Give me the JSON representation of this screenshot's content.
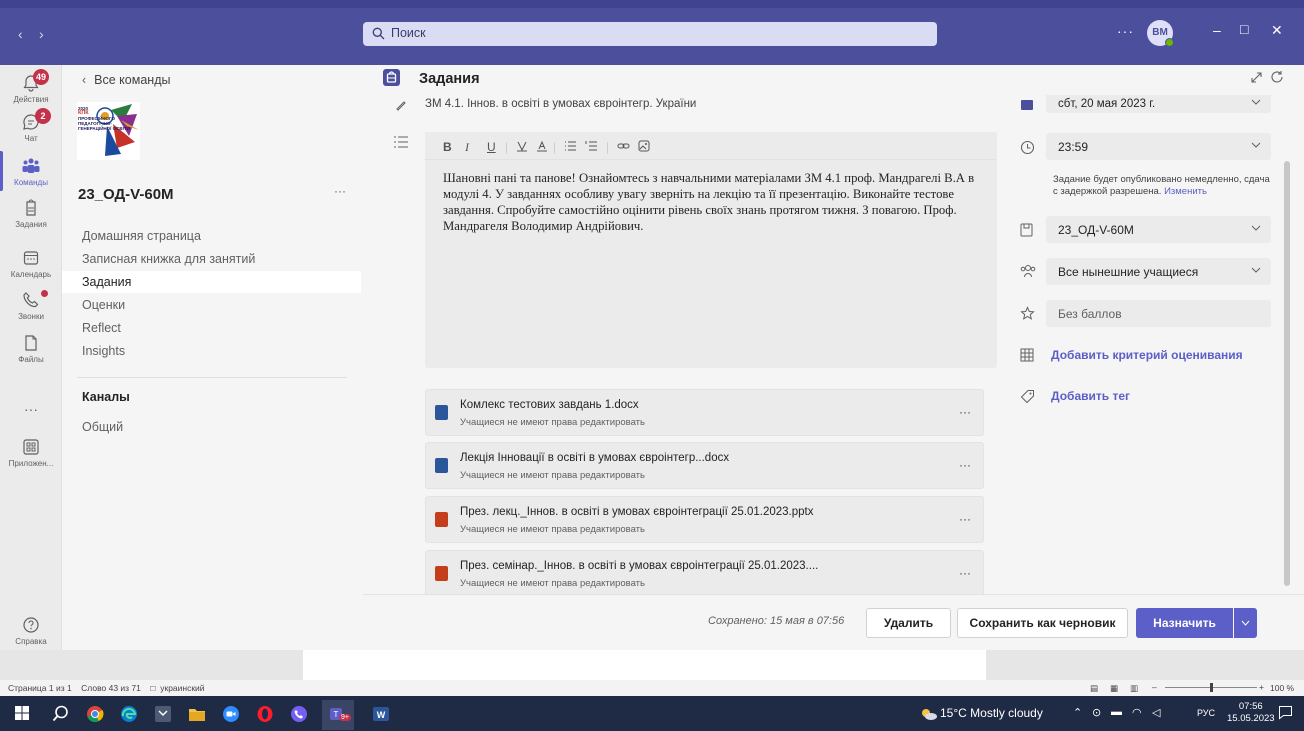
{
  "titlebar": {
    "search_placeholder": "Поиск",
    "more": "···",
    "avatar_initials": "ВМ"
  },
  "rail": {
    "items": [
      {
        "label": "Действия",
        "badge": "49"
      },
      {
        "label": "Чат",
        "badge": "2"
      },
      {
        "label": "Команды"
      },
      {
        "label": "Задания"
      },
      {
        "label": "Календарь"
      },
      {
        "label": "Звонки"
      },
      {
        "label": "Файлы"
      },
      {
        "label": "···"
      },
      {
        "label": "Приложен..."
      },
      {
        "label": "Справка"
      }
    ]
  },
  "team": {
    "back": "Все команды",
    "name": "23_ОД-V-60М",
    "more": "···",
    "logo_text": [
      "2020",
      "КПК",
      "ПРОФЕСІЙНОГО",
      "ПЕДАГОГІЧНО-",
      "ГЕНЕРАЦІЙНОЇ ОСВІТИ"
    ],
    "nav": [
      "Домашняя страница",
      "Записная книжка для занятий",
      "Задания",
      "Оценки",
      "Reflect",
      "Insights"
    ],
    "channels_title": "Каналы",
    "channels": [
      "Общий"
    ]
  },
  "main": {
    "title": "Задания",
    "assignment_title": "ЗМ 4.1. Іннов. в освіті в умовах євроінтегр. України",
    "description": "Шановні пані та панове! Ознайомтесь з навчальними матеріалами ЗМ 4.1 проф. Мандрагелі В.А в модулі 4. У завданнях особливу увагу зверніть на лекцію та її презентацію. Виконайте тестове завдання. Спробуйте самостійно оцінити рівень своїх знань протягом тижня. З повагою. Проф. Мандрагеля Володимир Андрійович.",
    "attachments": [
      {
        "name": "Комлекс тестових завдань 1.docx",
        "note": "Учащиеся не имеют права редактировать",
        "type": "word"
      },
      {
        "name": "Лекція Інновації в освіті в умовах євроінтегр...docx",
        "note": "Учащиеся не имеют права редактировать",
        "type": "word"
      },
      {
        "name": "През. лекц._Іннов. в освіті в умовах євроінтеграції 25.01.2023.pptx",
        "note": "Учащиеся не имеют права редактировать",
        "type": "ppt"
      },
      {
        "name": "През. семінар._Іннов. в освіті в умовах євроінтеграції 25.01.2023....",
        "note": "Учащиеся не имеют права редактировать",
        "type": "ppt"
      }
    ],
    "attachment_more": "···"
  },
  "right": {
    "due_date": "сбт, 20 мая 2023 г.",
    "due_time": "23:59",
    "publish_note": "Задание будет опубликовано немедленно, сдача с задержкой разрешена.",
    "publish_change": "Изменить",
    "class": "23_ОД-V-60М",
    "students": "Все нынешние учащиеся",
    "points": "Без баллов",
    "add_rubric": "Добавить критерий оценивания",
    "add_tag": "Добавить тег"
  },
  "footer": {
    "saved": "Сохранено: 15 мая в 07:56",
    "delete": "Удалить",
    "save_draft": "Сохранить как черновик",
    "assign": "Назначить"
  },
  "word_status": {
    "page": "Страница 1 из 1",
    "words": "Слово 43 из 71",
    "language": "украинский",
    "zoom": "100 %"
  },
  "taskbar": {
    "weather": "15°C  Mostly cloudy",
    "lang": "РУС",
    "time": "07:56",
    "date": "15.05.2023",
    "teams_badge": "9+"
  },
  "colors": {
    "teams_purple": "#4b4f9c",
    "accent": "#5b5fc7",
    "badge_red": "#c4314b"
  }
}
